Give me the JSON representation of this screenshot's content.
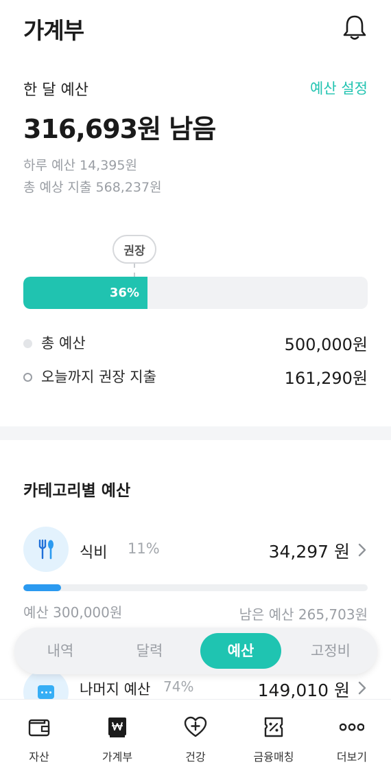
{
  "header": {
    "title": "가계부",
    "bell_icon": "bell-icon"
  },
  "budget": {
    "heading": "한 달 예산",
    "setting_link": "예산 설정",
    "remaining": "316,693원 남음",
    "daily": "하루 예산 14,395원",
    "expected": "총 예상 지출 568,237원",
    "recommend_badge": "권장",
    "progress_percent": 36,
    "progress_label": "36%",
    "accent_color": "#20c3b0",
    "legend": [
      {
        "label": "총 예산",
        "value": "500,000원"
      },
      {
        "label": "오늘까지 권장 지출",
        "value": "161,290원"
      }
    ]
  },
  "categories": {
    "title": "카테고리별 예산",
    "items": [
      {
        "icon": "fork-spoon-icon",
        "name": "식비",
        "percent": "11%",
        "amount": "34,297 원",
        "fill_percent": 11,
        "budget": "예산 300,000원",
        "left": "남은 예산 265,703원"
      },
      {
        "icon": "chat-dots-icon",
        "name": "나머지 예산",
        "percent": "74%",
        "amount": "149,010 원"
      }
    ]
  },
  "segments": {
    "tabs": [
      {
        "label": "내역",
        "active": false
      },
      {
        "label": "달력",
        "active": false
      },
      {
        "label": "예산",
        "active": true
      },
      {
        "label": "고정비",
        "active": false
      }
    ]
  },
  "tabbar": {
    "items": [
      {
        "label": "자산",
        "icon": "wallet-icon"
      },
      {
        "label": "가계부",
        "icon": "ledger-won-icon"
      },
      {
        "label": "건강",
        "icon": "heart-plus-icon"
      },
      {
        "label": "금융매칭",
        "icon": "coupon-percent-icon"
      },
      {
        "label": "더보기",
        "icon": "more-dots-icon"
      }
    ]
  }
}
